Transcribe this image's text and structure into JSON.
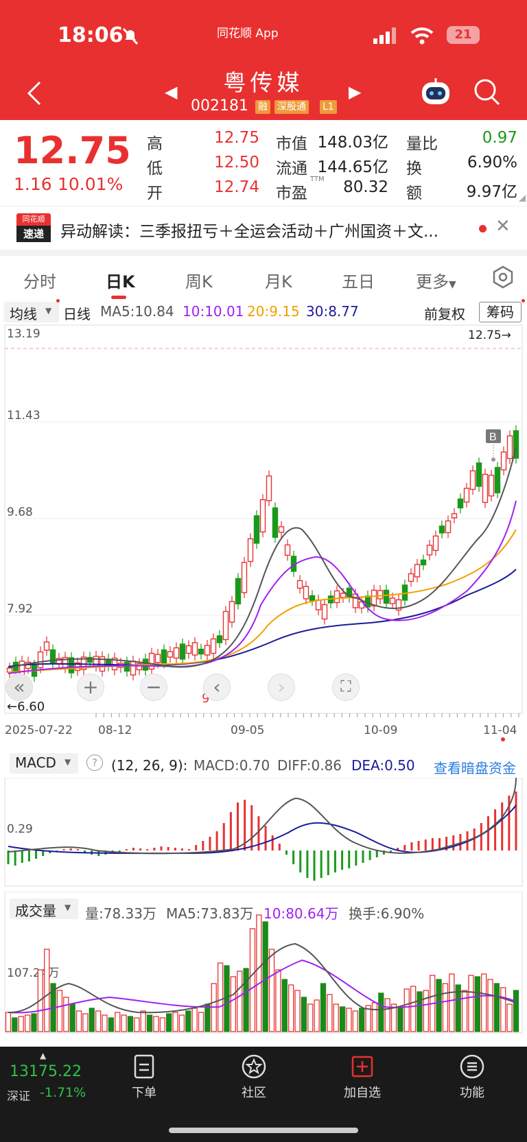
{
  "status_bar": {
    "time": "18:06",
    "app": "同花顺 App",
    "battery": "21"
  },
  "header": {
    "name": "粤传媒",
    "code": "002181",
    "tags": [
      "融",
      "深股通",
      "L1"
    ]
  },
  "quote": {
    "price": "12.75",
    "change": "1.16",
    "change_pct": "10.01%",
    "rows": [
      {
        "l1": "高",
        "v1": "12.75",
        "l2": "市值",
        "v2": "148.03亿",
        "l3": "量比",
        "v3": "0.97"
      },
      {
        "l1": "低",
        "v1": "12.50",
        "l2": "流通",
        "v2": "144.65亿",
        "l3": "换",
        "v3": "6.90%"
      },
      {
        "l1": "开",
        "v1": "12.74",
        "l2": "市盈",
        "l2sup": "TTM",
        "v2": "80.32",
        "l3": "额",
        "v3": "9.97亿"
      }
    ]
  },
  "news": {
    "logo_top": "同花顺",
    "logo_bottom": "速递",
    "text": "异动解读：三季报扭亏＋全运会活动＋广州国资＋文..."
  },
  "tabs": [
    "分时",
    "日K",
    "周K",
    "月K",
    "五日",
    "更多"
  ],
  "kline": {
    "ma_select": "均线",
    "period": "日线",
    "ma5": "MA5:10.84",
    "ma10": "10:10.01",
    "ma20": "20:9.15",
    "ma30": "30:8.77",
    "adjust": "前复权",
    "chips": "筹码",
    "price_labels": [
      "13.19",
      "11.43",
      "9.68",
      "7.92"
    ],
    "last_price_marker": "12.75→",
    "low_marker": "←6.60",
    "b_marker": "B",
    "bottom_marker": "9",
    "dates": [
      "2025-07-22",
      "08-12",
      "09-05",
      "10-09",
      "11-04"
    ]
  },
  "macd": {
    "name": "MACD",
    "params": "(12, 26, 9):",
    "macd": "MACD:0.70",
    "diff": "DIFF:0.86",
    "dea": "DEA:0.50",
    "link": "查看暗盘资金",
    "level": "0.29"
  },
  "volume": {
    "name": "成交量",
    "vol": "量:78.33万",
    "ma5": "MA5:73.83万",
    "ma10": "10:80.64万",
    "turnover": "换手:6.90%",
    "level": "107.24万"
  },
  "bottom_bar": {
    "index_value": "13175.22",
    "index_name": "深证",
    "index_change": "-1.71%",
    "items": [
      "下单",
      "社区",
      "加自选",
      "功能"
    ]
  },
  "colors": {
    "brand_red": "#e93030",
    "up": "#e93030",
    "down": "#1a9a1a",
    "ma5": "#555555",
    "ma10": "#a020f0",
    "ma20": "#f0a000",
    "ma30": "#1a1a9a"
  },
  "chart_data": {
    "type": "candlestick",
    "title": "",
    "xlabel": "",
    "ylabel": "",
    "ylim": [
      6.6,
      13.19
    ],
    "x": [
      "2025-07-22",
      "08-12",
      "09-05",
      "10-09",
      "11-04"
    ],
    "series": [
      {
        "name": "MA5",
        "values": [
          7.3,
          7.35,
          7.3,
          7.5,
          7.9,
          9.8,
          8.3,
          8.2,
          8.2,
          8.6,
          10.0,
          11.5
        ]
      },
      {
        "name": "MA10",
        "values": [
          7.3,
          7.35,
          7.3,
          7.45,
          7.7,
          9.2,
          8.7,
          8.1,
          8.1,
          8.4,
          9.4,
          10.3
        ]
      },
      {
        "name": "MA20",
        "values": [
          7.2,
          7.3,
          7.3,
          7.35,
          7.5,
          8.1,
          8.3,
          8.3,
          8.4,
          8.3,
          8.8,
          9.6
        ]
      },
      {
        "name": "MA30",
        "values": [
          7.25,
          7.3,
          7.3,
          7.3,
          7.4,
          7.8,
          8.0,
          8.1,
          8.2,
          8.2,
          8.5,
          9.1
        ]
      }
    ]
  }
}
